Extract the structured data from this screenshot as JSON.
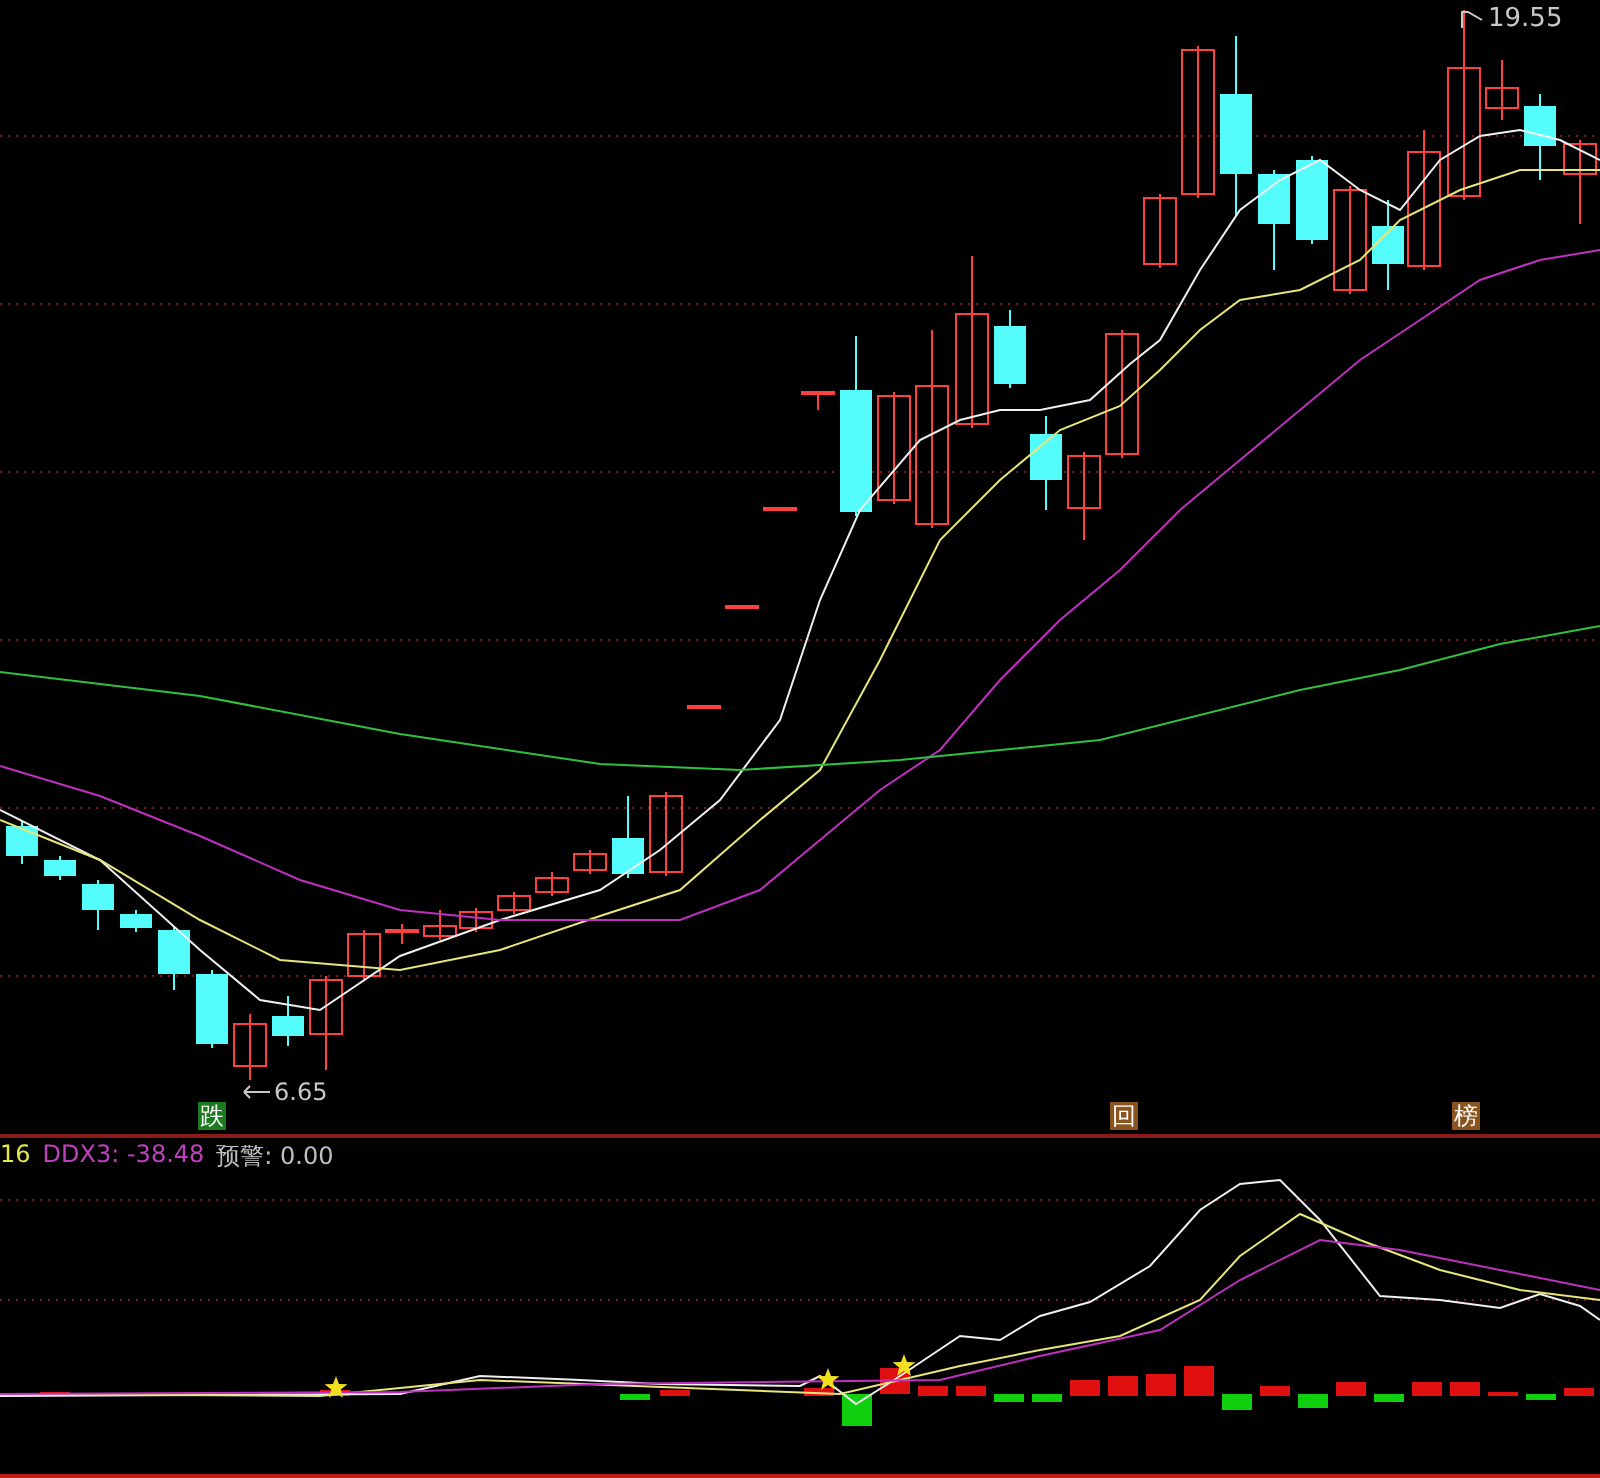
{
  "price_chart": {
    "low_label": "6.65",
    "high_label": "19.55",
    "signals": [
      {
        "label": "跌",
        "color": "#1e7a1e"
      },
      {
        "label": "回",
        "color": "#8a5420"
      },
      {
        "label": "榜",
        "color": "#8a5420"
      }
    ]
  },
  "indicator": {
    "readouts": [
      {
        "text": "16",
        "color": "#e8e84a"
      },
      {
        "text": "DDX3: -38.48",
        "color": "#c040c0"
      },
      {
        "text": "预警: 0.00",
        "color": "#c0c0c0"
      }
    ]
  }
}
